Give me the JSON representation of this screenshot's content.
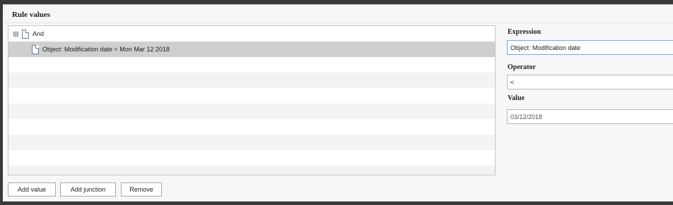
{
  "panel": {
    "title": "Rule values"
  },
  "tree": {
    "root": {
      "label": "And"
    },
    "children": [
      {
        "label": "Object: Modification date < Mon Mar 12 2018",
        "selected": true
      }
    ]
  },
  "buttons": {
    "add_value": "Add value",
    "add_junction": "Add junction",
    "remove": "Remove"
  },
  "form": {
    "expression": {
      "label": "Expression",
      "value": "Object: Modification date"
    },
    "operator": {
      "label": "Operator",
      "value": "<"
    },
    "value": {
      "label": "Value",
      "value": "03/12/2018"
    }
  },
  "colors": {
    "selection": "#cfcfcf",
    "focus_border": "#6ab2dc"
  },
  "icons": {
    "tree_collapse": "minus-box-icon",
    "node": "document-icon"
  }
}
